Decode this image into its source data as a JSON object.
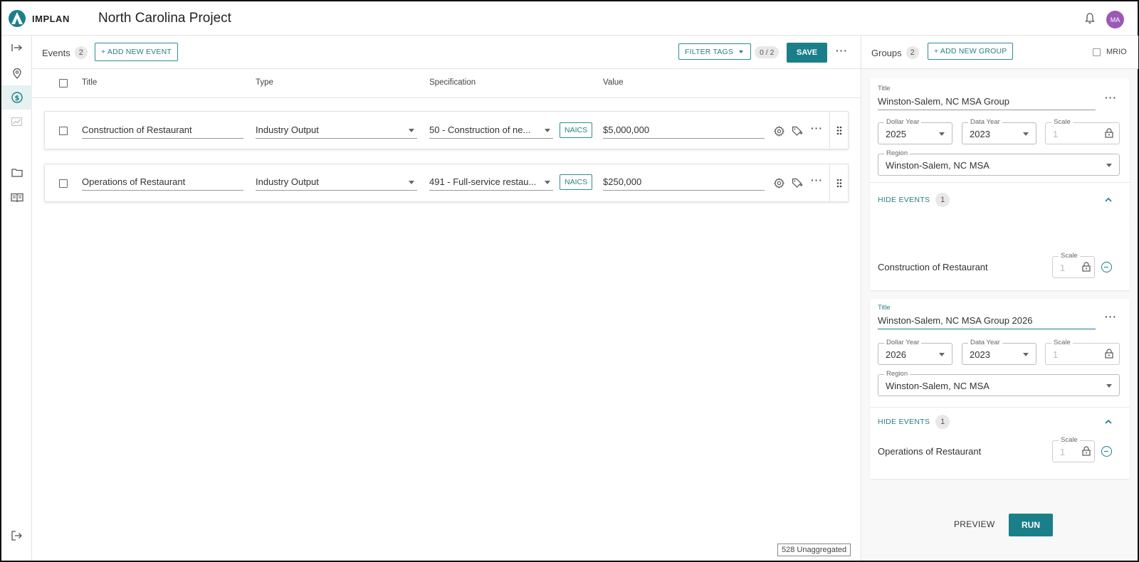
{
  "app": {
    "logo_text": "IMPLAN",
    "project_title": "North Carolina Project",
    "user_initials": "MA"
  },
  "rail": {
    "items": [
      "expand-icon",
      "location-pin-icon",
      "dollar-icon",
      "chart-icon",
      "folder-icon",
      "book-icon",
      "logout-icon"
    ]
  },
  "events": {
    "label": "Events",
    "count": "2",
    "add_button": "+ ADD NEW EVENT",
    "filter_tags": "FILTER TAGS",
    "selected_count": "0 / 2",
    "save_button": "SAVE",
    "columns": {
      "title": "Title",
      "type": "Type",
      "specification": "Specification",
      "value": "Value"
    },
    "rows": [
      {
        "title": "Construction of Restaurant",
        "type": "Industry Output",
        "specification": "50 - Construction of ne...",
        "code_type": "NAICS",
        "value": "$5,000,000"
      },
      {
        "title": "Operations of Restaurant",
        "type": "Industry Output",
        "specification": "491 - Full-service restau...",
        "code_type": "NAICS",
        "value": "$250,000"
      }
    ],
    "unaggregated": "528 Unaggregated"
  },
  "groups": {
    "label": "Groups",
    "count": "2",
    "add_button": "+ ADD NEW GROUP",
    "mrio_label": "MRIO",
    "title_label": "Title",
    "dollar_year_label": "Dollar Year",
    "data_year_label": "Data Year",
    "scale_label": "Scale",
    "region_label": "Region",
    "hide_events_label": "HIDE EVENTS",
    "cards": [
      {
        "title": "Winston-Salem, NC MSA Group",
        "dollar_year": "2025",
        "data_year": "2023",
        "scale": "1",
        "region": "Winston-Salem, NC MSA",
        "event_count": "1",
        "event_name": "Construction of Restaurant",
        "event_scale": "1"
      },
      {
        "title": "Winston-Salem, NC MSA Group 2026",
        "dollar_year": "2026",
        "data_year": "2023",
        "scale": "1",
        "region": "Winston-Salem, NC MSA",
        "event_count": "1",
        "event_name": "Operations of Restaurant",
        "event_scale": "1"
      }
    ],
    "preview_button": "PREVIEW",
    "run_button": "RUN"
  },
  "colors": {
    "accent": "#1b7f89",
    "avatar": "#9b59b6"
  }
}
